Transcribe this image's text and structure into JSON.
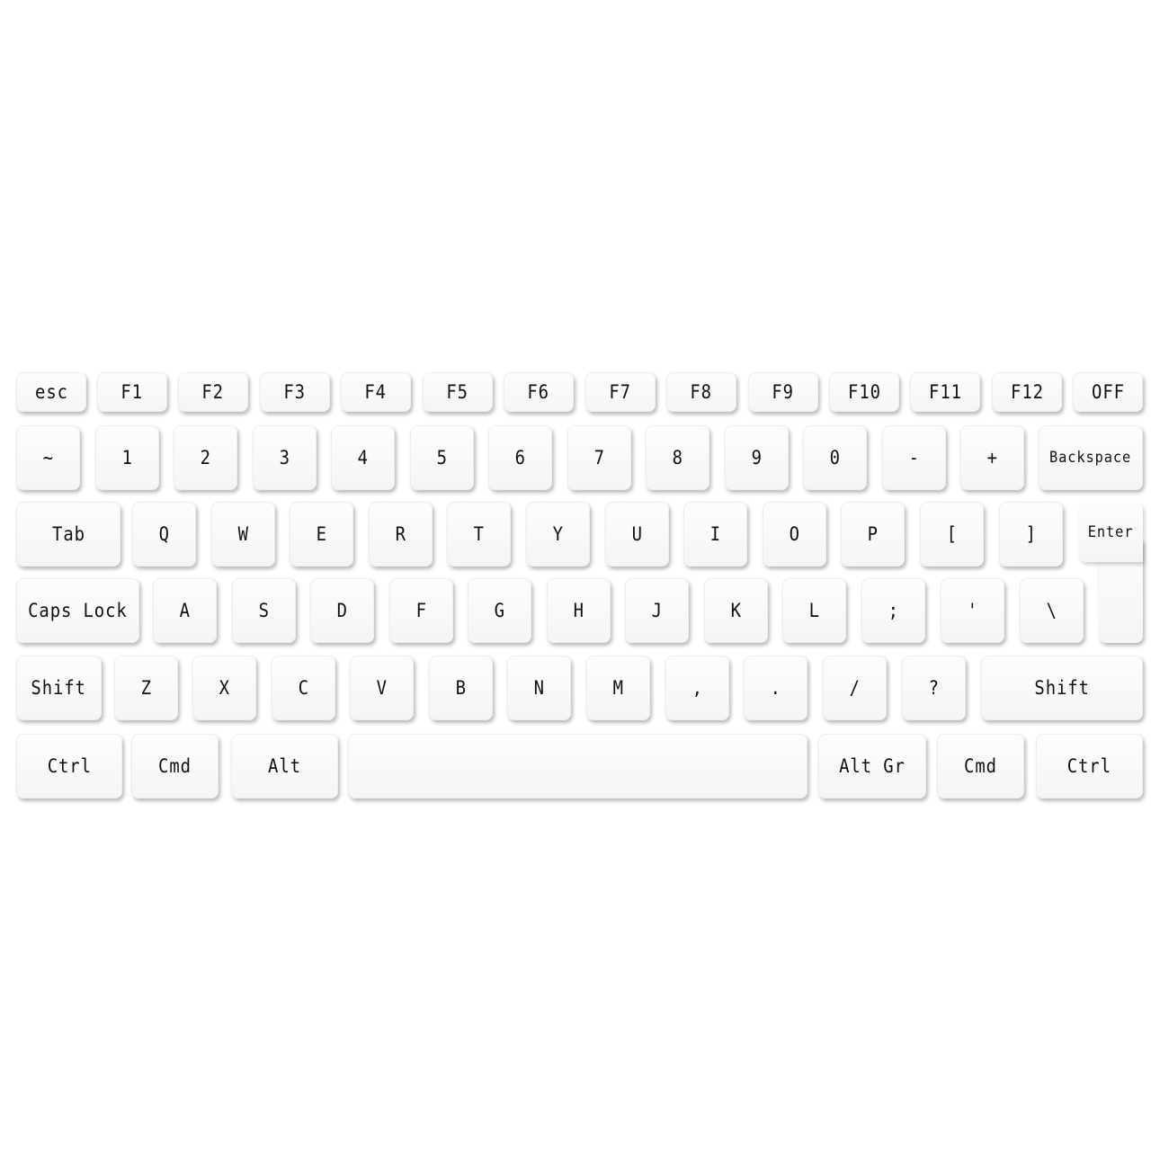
{
  "keyboard": {
    "rows": [
      [
        "esc",
        "F1",
        "F2",
        "F3",
        "F4",
        "F5",
        "F6",
        "F7",
        "F8",
        "F9",
        "F10",
        "F11",
        "F12",
        "OFF"
      ],
      [
        "~",
        "1",
        "2",
        "3",
        "4",
        "5",
        "6",
        "7",
        "8",
        "9",
        "0",
        "-",
        "+",
        "Backspace"
      ],
      [
        "Tab",
        "Q",
        "W",
        "E",
        "R",
        "T",
        "Y",
        "U",
        "I",
        "O",
        "P",
        "[",
        "]",
        "Enter"
      ],
      [
        "Caps Lock",
        "A",
        "S",
        "D",
        "F",
        "G",
        "H",
        "J",
        "K",
        "L",
        ";",
        "'",
        "\\"
      ],
      [
        "Shift",
        "Z",
        "X",
        "C",
        "V",
        "B",
        "N",
        "M",
        ",",
        ".",
        "/",
        "?",
        "Shift"
      ],
      [
        "Ctrl",
        "Cmd",
        "Alt",
        "",
        "Alt Gr",
        "Cmd",
        "Ctrl"
      ]
    ]
  }
}
